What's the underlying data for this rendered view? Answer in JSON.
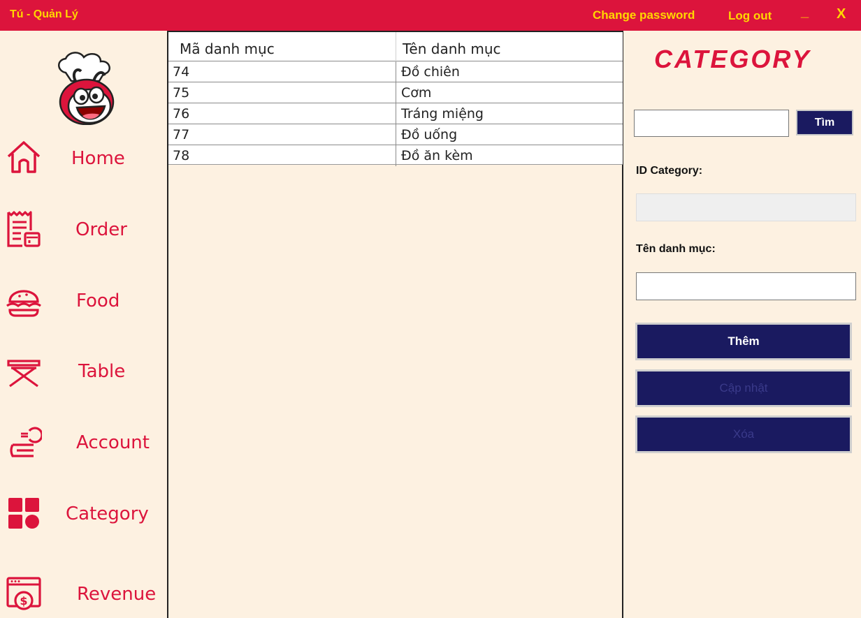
{
  "titlebar": {
    "user_label": "Tú - Quản Lý",
    "change_password": "Change password",
    "logout": "Log out",
    "minimize": "_",
    "close": "X"
  },
  "colors": {
    "accent": "#dc143c",
    "title_text": "#ffd700",
    "button_bg": "#1a1a60",
    "page_bg": "#fdf1e1"
  },
  "sidebar": {
    "logo_icon": "mascot-logo-icon",
    "items": [
      {
        "label": "Home",
        "icon": "home-icon"
      },
      {
        "label": "Order",
        "icon": "receipt-icon"
      },
      {
        "label": "Food",
        "icon": "burger-icon"
      },
      {
        "label": "Table",
        "icon": "table-icon"
      },
      {
        "label": "Account",
        "icon": "coin-hand-icon"
      },
      {
        "label": "Category",
        "icon": "grid-icon"
      },
      {
        "label": "Revenue",
        "icon": "revenue-icon"
      }
    ]
  },
  "table": {
    "columns": [
      "Mã danh mục",
      "Tên danh mục"
    ],
    "rows": [
      {
        "id": "74",
        "name": "Đồ chiên"
      },
      {
        "id": "75",
        "name": "Cơm"
      },
      {
        "id": "76",
        "name": "Tráng miệng"
      },
      {
        "id": "77",
        "name": "Đồ uống"
      },
      {
        "id": "78",
        "name": "Đồ ăn kèm"
      }
    ]
  },
  "form": {
    "heading": "CATEGORY",
    "search_value": "",
    "search_button": "Tìm",
    "id_label": "ID Category:",
    "id_value": "",
    "name_label": "Tên danh mục:",
    "name_value": "",
    "add_button": "Thêm",
    "update_button": "Cập nhật",
    "delete_button": "Xóa"
  }
}
